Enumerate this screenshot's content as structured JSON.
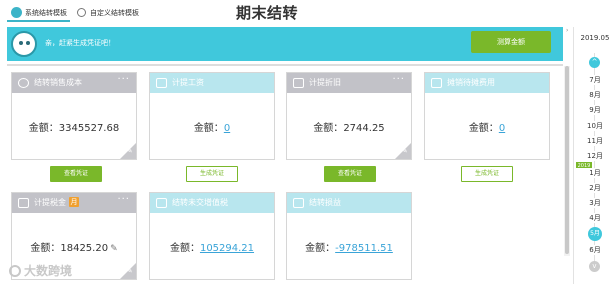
{
  "tabs": [
    {
      "label": "系统结转模板",
      "active": true
    },
    {
      "label": "自定义结转模板",
      "active": false
    }
  ],
  "page_title": "期末结转",
  "banner": {
    "message": "亲，赶紧生成凭证吧！",
    "action_label": "测算金额"
  },
  "amount_prefix": "金额：",
  "cards": [
    {
      "title": "结转销售成本",
      "amount": "3345527.68",
      "amount_is_link": false,
      "button": "查看凭证",
      "button_style": "solid",
      "icon": "clock-icon"
    },
    {
      "title": "计提工资",
      "amount": "0",
      "amount_is_link": true,
      "button": "生成凭证",
      "button_style": "outline",
      "icon": "wallet-icon"
    },
    {
      "title": "计提折旧",
      "amount": "2744.25",
      "amount_is_link": false,
      "button": "查看凭证",
      "button_style": "solid",
      "icon": "copy-icon"
    },
    {
      "title": "摊销待摊费用",
      "amount": "0",
      "amount_is_link": true,
      "button": "生成凭证",
      "button_style": "outline",
      "icon": "box-icon"
    },
    {
      "title": "计提税金",
      "badge": "月",
      "amount": "18425.20",
      "amount_is_link": false,
      "icon": "document-icon"
    },
    {
      "title": "结转未交增值税",
      "amount": "105294.21",
      "amount_is_link": true,
      "icon": "grid-icon"
    },
    {
      "title": "结转损益",
      "amount": "-978511.51",
      "amount_is_link": true,
      "icon": "plus-icon"
    }
  ],
  "calendar": {
    "header": "2019.05",
    "up_icon": "^",
    "down_icon": "v",
    "months": [
      "7月",
      "8月",
      "9月",
      "10月",
      "11月",
      "12月",
      "1月",
      "2月",
      "3月",
      "4月",
      "5月",
      "6月"
    ],
    "year_marker": "2019",
    "selected": "5月"
  },
  "watermark": "大数跨境",
  "colors": {
    "accent": "#40c8dc",
    "green": "#7ab82a",
    "link": "#3aa4d8",
    "card_head_gray": "#c2c2c8",
    "card_head_teal": "#b8e6ee"
  }
}
